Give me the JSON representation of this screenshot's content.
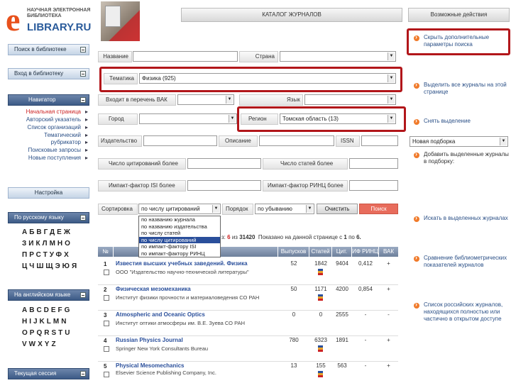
{
  "logo": {
    "letter": "e",
    "line1": "НАУЧНАЯ ЭЛЕКТРОННАЯ\nБИБЛИОТЕКА",
    "line2": "LIBRARY.RU"
  },
  "header": {
    "catalog_title": "КАТАЛОГ ЖУРНАЛОВ",
    "actions_title": "Возможные действия"
  },
  "sidebar": {
    "search_label": "Поиск в библиотеке",
    "login_label": "Вход в библиотеку",
    "nav_label": "Навигатор",
    "nav_items": [
      "Начальная страница",
      "Авторский указатель",
      "Список организаций",
      "Тематический",
      "рубрикатор",
      "Поисковые запросы",
      "Новые поступления",
      "Настройка"
    ],
    "ru_label": "По русскому языку",
    "ru_letters": [
      "АБВГДЕЖ",
      "ЗИКЛМНО",
      "ПРСТУФХ",
      "ЦЧШЩЭЮЯ"
    ],
    "en_label": "На английском языке",
    "en_letters": [
      "ABCDEFG",
      "HIJKLMN",
      "OPQRSTU",
      "VWXYZ"
    ],
    "session_label": "Текущая сессия"
  },
  "form": {
    "title_label": "Название",
    "country_label": "Страна",
    "topic_label": "Тематика",
    "topic_value": "Физика (925)",
    "vak_label": "Входит в перечень ВАК",
    "lang_label": "Язык",
    "city_label": "Город",
    "region_label": "Регион",
    "region_value": "Томская область (13)",
    "publisher_label": "Издательство",
    "desc_label": "Описание",
    "issn_label": "ISSN",
    "cited_label": "Число цитирований более",
    "articles_label": "Число статей более",
    "if_isi_label": "Импакт-фактор ISI более",
    "if_rinc_label": "Импакт-фактор РИНЦ более",
    "sort_label": "Сортировка",
    "sort_value": "по числу цитирований",
    "order_label": "Порядок",
    "order_value": "по убыванию",
    "clear_button": "Очистить",
    "search_button": "Поиск"
  },
  "sort_options": [
    "по названию журнала",
    "по названию издательства",
    "по числу статей",
    "по числу цитирований",
    "по импакт-фактору ISI",
    "по импакт-фактору РИНЦ"
  ],
  "results": {
    "prefix": "з:",
    "shown": "6",
    "of": "из",
    "total": "31420",
    "page_text": "Показано на данной странице с",
    "from": "1",
    "to_word": "по",
    "to": "6."
  },
  "table": {
    "headers": [
      "№",
      "Выпусков",
      "Статей",
      "Цит.",
      "ИФ РИНЦ",
      "ВАК"
    ],
    "rows": [
      {
        "num": "1",
        "title": "Известия высших учебных заведений. Физика",
        "publisher": "ООО \"Издательство научно-технической литературы\"",
        "issues": "52",
        "articles": "1842",
        "cites": "9404",
        "if": "0,412",
        "vak": "+"
      },
      {
        "num": "2",
        "title": "Физическая мезомеханика",
        "publisher": "Институт физики прочности и материаловедения СО РАН",
        "issues": "50",
        "articles": "1171",
        "cites": "4200",
        "if": "0,854",
        "vak": "+"
      },
      {
        "num": "3",
        "title": "Atmospheric and Oceanic Optics",
        "publisher": "Институт оптики атмосферы им. В.Е. Зуева СО РАН",
        "issues": "0",
        "articles": "0",
        "cites": "2555",
        "if": "-",
        "vak": "-"
      },
      {
        "num": "4",
        "title": "Russian Physics Journal",
        "publisher": "Springer New York Consultants Bureau",
        "issues": "780",
        "articles": "6323",
        "cites": "1891",
        "if": "-",
        "vak": "+"
      },
      {
        "num": "5",
        "title": "Physical Mesomechanics",
        "publisher": "Elsevier Science Publishing Company, Inc.",
        "issues": "13",
        "articles": "155",
        "cites": "563",
        "if": "-",
        "vak": "+"
      }
    ]
  },
  "actions": [
    {
      "label": "Скрыть дополнительные параметры поиска"
    },
    {
      "label": "Выделить все журналы на этой странице"
    },
    {
      "label": "Снять выделение"
    },
    {
      "label": "Добавить выделенные журналы в подборку:"
    },
    {
      "label": "Искать в выделенных журналах"
    },
    {
      "label": "Сравнение библиометрических показателей журналов"
    },
    {
      "label": "Список российских журналов, находящихся полностью или частично в открытом доступе"
    }
  ],
  "collection_select": "Новая подборка",
  "colors": {
    "highlight": "#b2161a",
    "accent": "#e8511c",
    "link": "#2a4f9b"
  }
}
